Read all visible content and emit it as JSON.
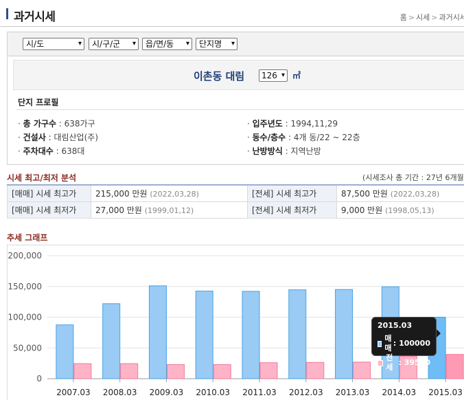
{
  "header": {
    "title": "과거시세",
    "breadcrumb": [
      "홈",
      "시세",
      "과거시세"
    ],
    "breadcrumb_sep": ">"
  },
  "filters": {
    "sido": "시/도",
    "sigungu": "시/구/군",
    "dong": "읍/면/동",
    "complex": "단지명",
    "arrow": "▾"
  },
  "apartment": {
    "name": "이촌동 대림",
    "size": "126",
    "unit": "㎡"
  },
  "profile": {
    "label": "단지 프로필",
    "items": [
      {
        "key": "총 가구수",
        "value": "638가구"
      },
      {
        "key": "입주년도",
        "value": "1994,11,29"
      },
      {
        "key": "건설사",
        "value": "대림산업(주)"
      },
      {
        "key": "동수/층수",
        "value": "4개 동/22 ~ 22층"
      },
      {
        "key": "주차대수",
        "value": "638대"
      },
      {
        "key": "난방방식",
        "value": "지역난방"
      }
    ]
  },
  "stats": {
    "title": "시세 최고/최저 분석",
    "period": "(시세조사 총 기간 : 27년 6개월)",
    "rows": [
      [
        {
          "label": "[매매] 시세 최고가",
          "value": "215,000 만원",
          "date": "(2022,03,28)"
        },
        {
          "label": "[전세] 시세 최고가",
          "value": "87,500 만원",
          "date": "(2022,03,28)"
        }
      ],
      [
        {
          "label": "[매매] 시세 최저가",
          "value": "27,000 만원",
          "date": "(1999,01,12)"
        },
        {
          "label": "[전세] 시세 최저가",
          "value": "9,000 만원",
          "date": "(1998,05,13)"
        }
      ]
    ]
  },
  "trend_title": "추세 그래프",
  "tooltip": {
    "title": "2015.03",
    "sale_label": "매매",
    "sale_value": "100000",
    "lease_label": "전세",
    "lease_value": "39500"
  },
  "colors": {
    "sale_fill": "#99cbf5",
    "sale_stroke": "#4aa2e3",
    "lease_fill": "#ffb3c7",
    "lease_stroke": "#f07a98",
    "sale_highlight": "#6fbdf6",
    "lease_highlight": "#ff9ab4"
  },
  "chart_data": {
    "type": "bar",
    "categories": [
      "2007.03",
      "2008.03",
      "2009.03",
      "2010.03",
      "2011.03",
      "2012.03",
      "2013.03",
      "2014.03",
      "2015.03"
    ],
    "series": [
      {
        "name": "매매",
        "values": [
          87500,
          122000,
          151000,
          142500,
          142000,
          144500,
          145000,
          149500,
          100000
        ]
      },
      {
        "name": "전세",
        "values": [
          24500,
          24500,
          23000,
          23000,
          26000,
          26500,
          27000,
          36500,
          39500
        ]
      }
    ],
    "ylim": [
      0,
      200000
    ],
    "yticks": [
      "0",
      "50,000",
      "100,000",
      "150,000",
      "200,000"
    ],
    "grid": true,
    "highlight_category": "2015.03"
  }
}
